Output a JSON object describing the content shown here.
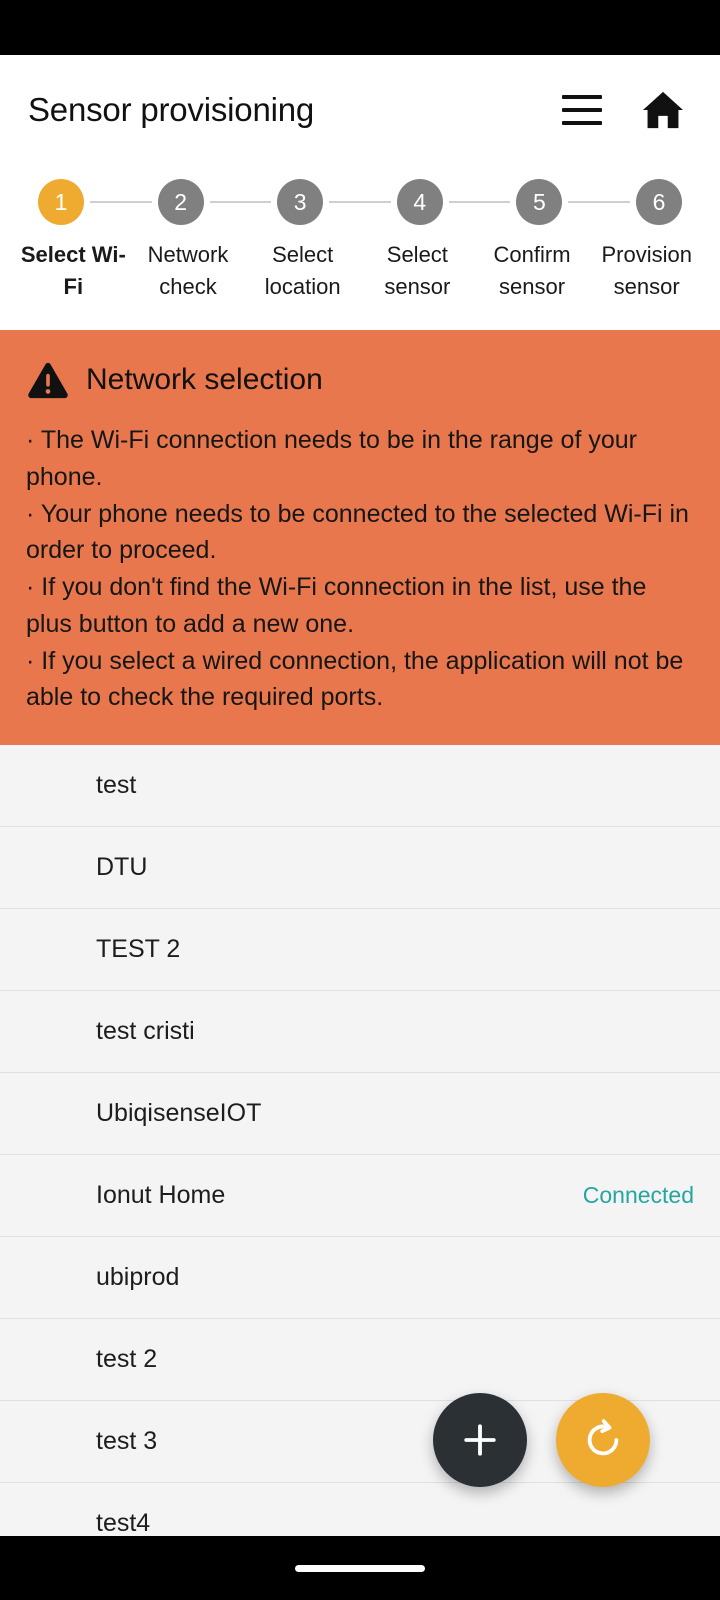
{
  "header": {
    "title": "Sensor provisioning",
    "menu_icon": "hamburger-menu-icon",
    "home_icon": "home-icon"
  },
  "stepper": {
    "current_step": 1,
    "steps": [
      {
        "number": "1",
        "label": "Select Wi-Fi",
        "active": true
      },
      {
        "number": "2",
        "label": "Network check",
        "active": false
      },
      {
        "number": "3",
        "label": "Select location",
        "active": false
      },
      {
        "number": "4",
        "label": "Select sensor",
        "active": false
      },
      {
        "number": "5",
        "label": "Confirm sensor",
        "active": false
      },
      {
        "number": "6",
        "label": "Provision sensor",
        "active": false
      }
    ]
  },
  "warning": {
    "icon": "warning-triangle-icon",
    "title": "Network selection",
    "lines": [
      "· The Wi-Fi connection needs to be in the range of your phone.",
      "· Your phone needs to be connected to the selected Wi-Fi in order to proceed.",
      "· If you don't find the Wi-Fi connection in the list, use the plus button to add a new one.",
      "· If you select a wired connection, the application will not be able to check the required ports."
    ]
  },
  "network_list": [
    {
      "name": "test",
      "status": ""
    },
    {
      "name": "DTU",
      "status": ""
    },
    {
      "name": "TEST 2",
      "status": ""
    },
    {
      "name": "test cristi",
      "status": ""
    },
    {
      "name": "UbiqisenseIOT",
      "status": ""
    },
    {
      "name": "Ionut Home",
      "status": "Connected"
    },
    {
      "name": "ubiprod",
      "status": ""
    },
    {
      "name": "test 2",
      "status": ""
    },
    {
      "name": "test 3",
      "status": ""
    },
    {
      "name": "test4",
      "status": ""
    }
  ],
  "fabs": {
    "add": {
      "icon": "plus-icon",
      "label": ""
    },
    "refresh": {
      "icon": "refresh-icon",
      "label": ""
    }
  },
  "colors": {
    "accent_amber": "#EFAB30",
    "warning_orange": "#E8774E",
    "connected_teal": "#26A6A0",
    "fab_dark": "#2B3035",
    "step_inactive": "#808080"
  }
}
